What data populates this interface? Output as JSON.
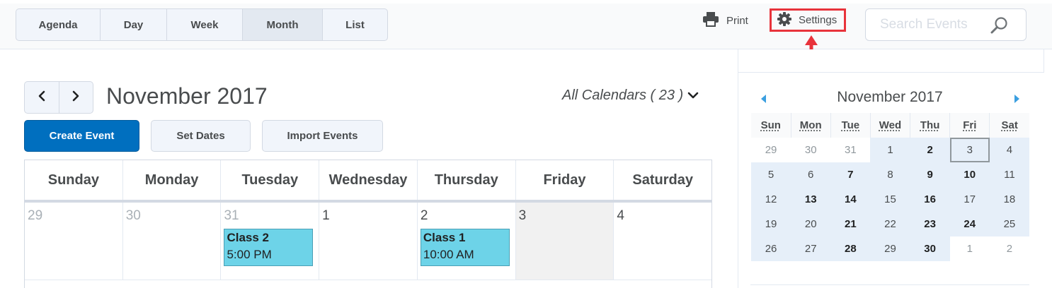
{
  "views": {
    "tabs": [
      {
        "label": "Agenda",
        "active": false
      },
      {
        "label": "Day",
        "active": false
      },
      {
        "label": "Week",
        "active": false
      },
      {
        "label": "Month",
        "active": true
      },
      {
        "label": "List",
        "active": false
      }
    ]
  },
  "toolbar": {
    "print_label": "Print",
    "settings_label": "Settings",
    "search_placeholder": "Search Events"
  },
  "main": {
    "title": "November 2017",
    "calendar_filter": "All Calendars ( 23 )",
    "buttons": {
      "create": "Create Event",
      "set_dates": "Set Dates",
      "import": "Import Events"
    },
    "weekdays": [
      "Sunday",
      "Monday",
      "Tuesday",
      "Wednesday",
      "Thursday",
      "Friday",
      "Saturday"
    ],
    "week1": [
      {
        "day": "29",
        "other": true
      },
      {
        "day": "30",
        "other": true
      },
      {
        "day": "31",
        "other": true
      },
      {
        "day": "1",
        "other": false
      },
      {
        "day": "2",
        "other": false
      },
      {
        "day": "3",
        "other": false,
        "shaded": true
      },
      {
        "day": "4",
        "other": false
      }
    ],
    "events": {
      "class2": {
        "title": "Class 2",
        "time": "5:00 PM"
      },
      "class1": {
        "title": "Class 1",
        "time": "10:00 AM"
      }
    }
  },
  "mini_calendar": {
    "title": "November 2017",
    "weekdays": [
      "Sun",
      "Mon",
      "Tue",
      "Wed",
      "Thu",
      "Fri",
      "Sat"
    ],
    "weeks": [
      [
        [
          "29",
          "other"
        ],
        [
          "30",
          "other"
        ],
        [
          "31",
          "other"
        ],
        [
          "1",
          ""
        ],
        [
          "2",
          "bold"
        ],
        [
          "3",
          "today"
        ],
        [
          "4",
          ""
        ]
      ],
      [
        [
          "5",
          ""
        ],
        [
          "6",
          ""
        ],
        [
          "7",
          "bold"
        ],
        [
          "8",
          ""
        ],
        [
          "9",
          "bold"
        ],
        [
          "10",
          "bold"
        ],
        [
          "11",
          ""
        ]
      ],
      [
        [
          "12",
          ""
        ],
        [
          "13",
          "bold"
        ],
        [
          "14",
          "bold"
        ],
        [
          "15",
          ""
        ],
        [
          "16",
          "bold"
        ],
        [
          "17",
          ""
        ],
        [
          "18",
          ""
        ]
      ],
      [
        [
          "19",
          ""
        ],
        [
          "20",
          ""
        ],
        [
          "21",
          "bold"
        ],
        [
          "22",
          ""
        ],
        [
          "23",
          "bold"
        ],
        [
          "24",
          "bold"
        ],
        [
          "25",
          ""
        ]
      ],
      [
        [
          "26",
          ""
        ],
        [
          "27",
          ""
        ],
        [
          "28",
          "bold"
        ],
        [
          "29",
          ""
        ],
        [
          "30",
          "bold"
        ],
        [
          "1",
          "other"
        ],
        [
          "2",
          "other"
        ]
      ]
    ]
  },
  "colors": {
    "primary": "#006fbf",
    "highlight_border": "#e8333b",
    "event_fill": "#6dd3e8",
    "mini_inmonth": "#e6eff9"
  },
  "icons": [
    "print-icon",
    "gear-icon",
    "search-icon",
    "chevron-left-icon",
    "chevron-right-icon",
    "chevron-down-icon",
    "triangle-left-icon",
    "triangle-right-icon",
    "red-arrow-up"
  ]
}
